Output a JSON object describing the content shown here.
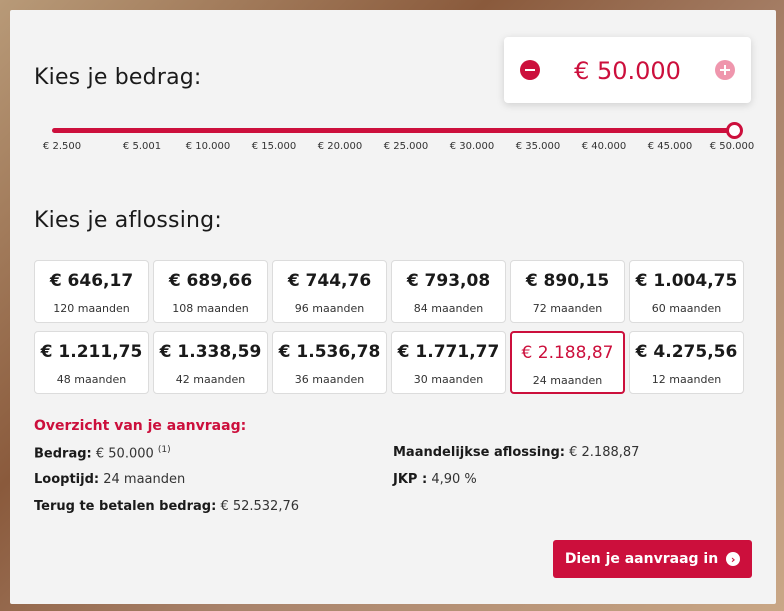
{
  "amount_section": {
    "heading": "Kies je bedrag:",
    "value": "€ 50.000",
    "slider_fraction": 1.0,
    "ticks": [
      "€ 2.500",
      "€ 5.001",
      "€ 10.000",
      "€ 15.000",
      "€ 20.000",
      "€ 25.000",
      "€ 30.000",
      "€ 35.000",
      "€ 40.000",
      "€ 45.000",
      "€ 50.000"
    ]
  },
  "term_section": {
    "heading": "Kies je aflossing:",
    "options": [
      {
        "amount": "€ 646,17",
        "months": "120 maanden"
      },
      {
        "amount": "€ 689,66",
        "months": "108 maanden"
      },
      {
        "amount": "€ 744,76",
        "months": "96 maanden"
      },
      {
        "amount": "€ 793,08",
        "months": "84 maanden"
      },
      {
        "amount": "€ 890,15",
        "months": "72 maanden"
      },
      {
        "amount": "€ 1.004,75",
        "months": "60 maanden"
      },
      {
        "amount": "€ 1.211,75",
        "months": "48 maanden"
      },
      {
        "amount": "€ 1.338,59",
        "months": "42 maanden"
      },
      {
        "amount": "€ 1.536,78",
        "months": "36 maanden"
      },
      {
        "amount": "€ 1.771,77",
        "months": "30 maanden"
      },
      {
        "amount": "€ 2.188,87",
        "months": "24 maanden"
      },
      {
        "amount": "€ 4.275,56",
        "months": "12 maanden"
      }
    ],
    "selected_index": 10
  },
  "overview": {
    "title": "Overzicht van je aanvraag:",
    "bedrag_label": "Bedrag:",
    "bedrag_value": "€ 50.000",
    "bedrag_note": "(1)",
    "looptijd_label": "Looptijd:",
    "looptijd_value": "24 maanden",
    "terug_label": "Terug te betalen bedrag:",
    "terug_value": "€ 52.532,76",
    "maand_label": "Maandelijkse aflossing:",
    "maand_value": "€ 2.188,87",
    "jkp_label": "JKP :",
    "jkp_value": "4,90 %"
  },
  "submit": {
    "label": "Dien je aanvraag in",
    "icon": "chevron-right-circle-icon"
  },
  "colors": {
    "accent": "#cc0f3c",
    "accent_light": "#ef96ad",
    "panel": "#f3f3f3"
  }
}
